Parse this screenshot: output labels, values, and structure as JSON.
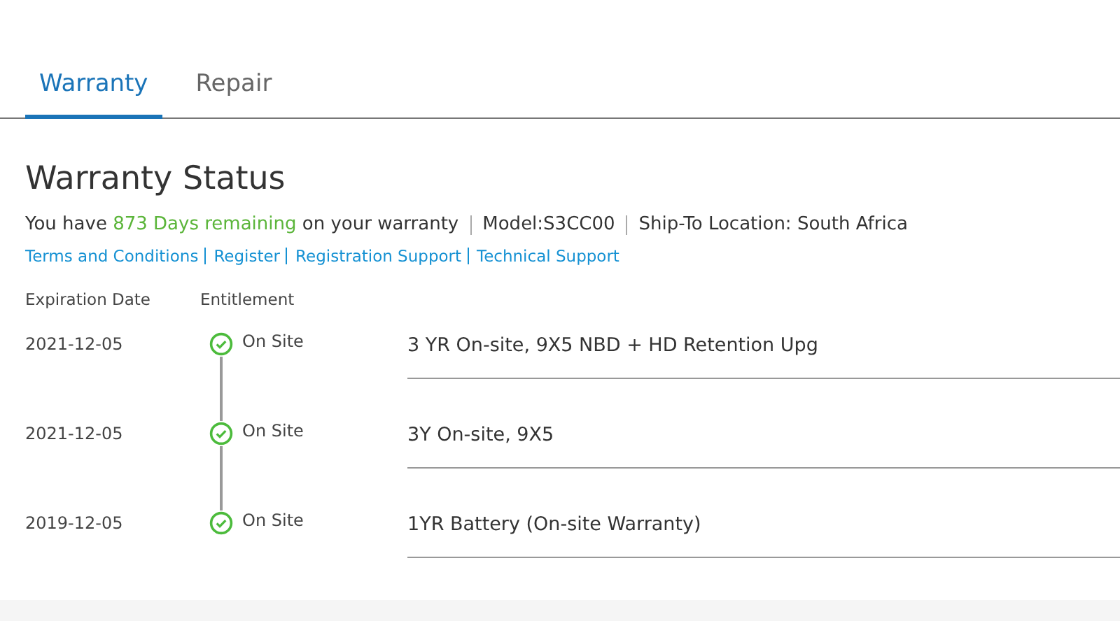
{
  "tabs": [
    {
      "label": "Warranty",
      "selected": true
    },
    {
      "label": "Repair",
      "selected": false
    }
  ],
  "title": "Warranty Status",
  "status": {
    "before": "You have",
    "highlight": "873 Days remaining",
    "after": "on your warranty",
    "model": "Model:S3CC00",
    "location": "Ship-To Location: South Africa"
  },
  "links": [
    "Terms and Conditions",
    "Register",
    "Registration Support",
    "Technical Support"
  ],
  "table": {
    "columns": [
      "Expiration Date",
      "Entitlement"
    ],
    "rows": [
      {
        "date": "2021-12-05",
        "entitlement": "On Site",
        "description": "3 YR On-site, 9X5 NBD + HD Retention Upg"
      },
      {
        "date": "2021-12-05",
        "entitlement": "On Site",
        "description": "3Y On-site, 9X5"
      },
      {
        "date": "2019-12-05",
        "entitlement": "On Site",
        "description": "1YR Battery (On-site Warranty)"
      }
    ]
  }
}
